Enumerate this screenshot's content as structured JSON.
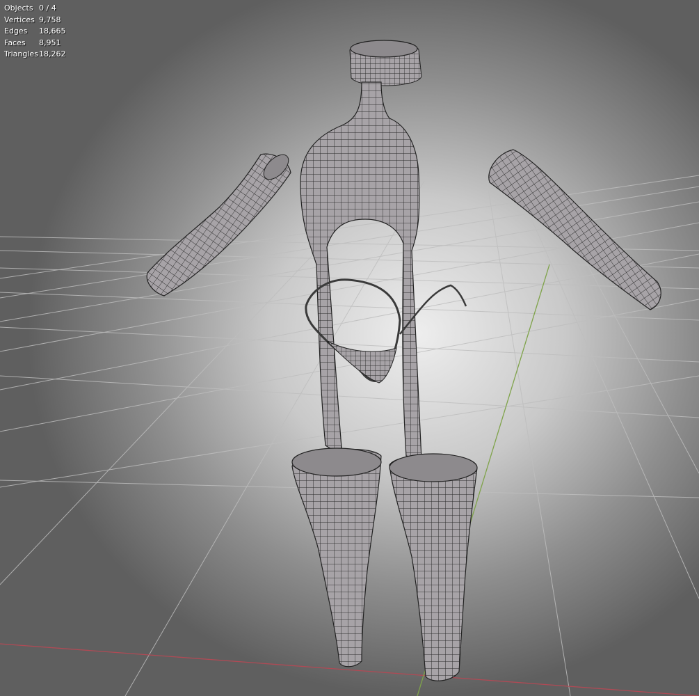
{
  "viewport": {
    "stats": [
      {
        "label": "Objects",
        "value": "0 / 4"
      },
      {
        "label": "Vertices",
        "value": "9,758"
      },
      {
        "label": "Edges",
        "value": "18,665"
      },
      {
        "label": "Faces",
        "value": "8,951"
      },
      {
        "label": "Triangles",
        "value": "18,262"
      }
    ]
  },
  "colors": {
    "mesh_fill": "#a6a2a6",
    "wire": "#2b2b2b",
    "grid": "#bdbdbd",
    "x_axis": "#b04a55",
    "y_axis": "#7fa34a",
    "text": "#ffffff"
  }
}
